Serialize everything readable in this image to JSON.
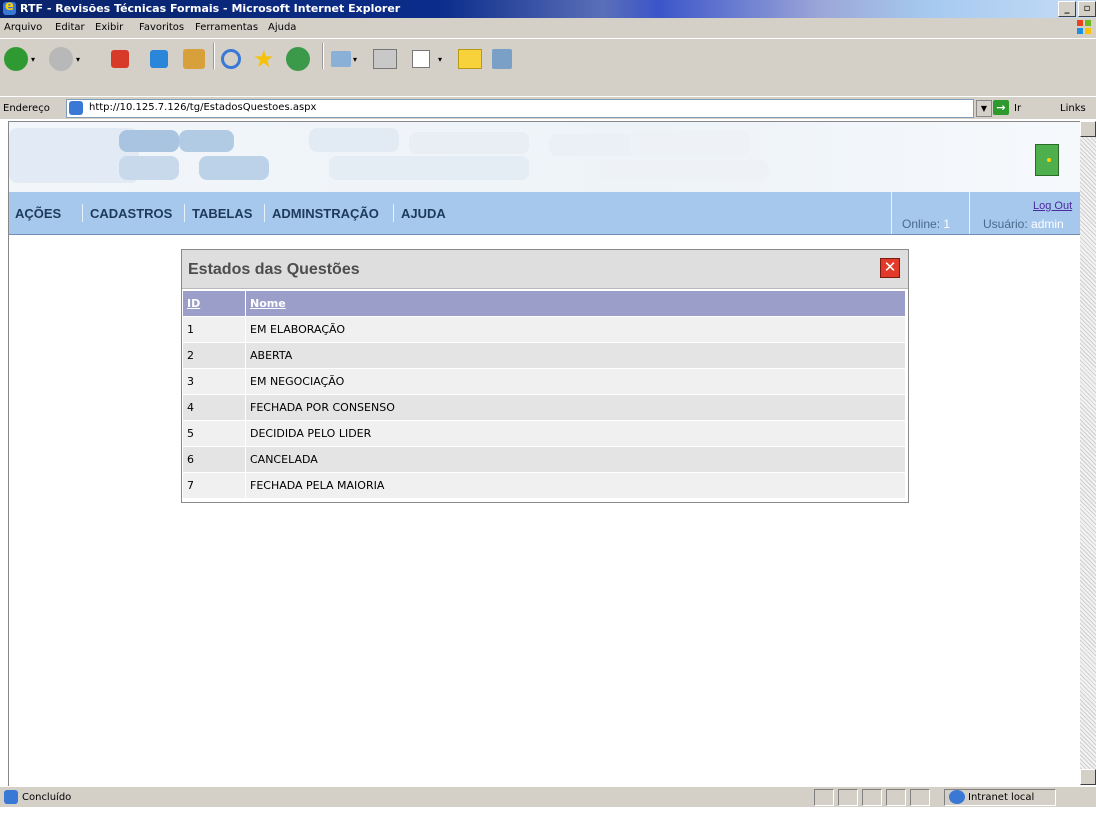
{
  "window": {
    "title": "RTF - Revisões Técnicas Formais - Microsoft Internet Explorer"
  },
  "menu": [
    "Arquivo",
    "Editar",
    "Exibir",
    "Favoritos",
    "Ferramentas",
    "Ajuda"
  ],
  "address": {
    "label": "Endereço",
    "url": "http://10.125.7.126/tg/EstadosQuestoes.aspx",
    "go": "Ir",
    "links": "Links"
  },
  "nav": {
    "items": [
      "AÇÕES",
      "CADASTROS",
      "TABELAS",
      "ADMINSTRAÇÃO",
      "AJUDA"
    ],
    "online_label": "Online:",
    "online_value": "1",
    "logout": "Log Out",
    "user_label": "Usuário:",
    "user_value": "admin"
  },
  "panel": {
    "title": "Estados das Questões",
    "columns": [
      "ID",
      "Nome"
    ],
    "rows": [
      [
        "1",
        "EM ELABORAÇÃO"
      ],
      [
        "2",
        "ABERTA"
      ],
      [
        "3",
        "EM NEGOCIAÇÃO"
      ],
      [
        "4",
        "FECHADA POR CONSENSO"
      ],
      [
        "5",
        "DECIDIDA PELO LIDER"
      ],
      [
        "6",
        "CANCELADA"
      ],
      [
        "7",
        "FECHADA PELA MAIORIA"
      ]
    ]
  },
  "status": {
    "text": "Concluído",
    "zone": "Intranet local"
  }
}
